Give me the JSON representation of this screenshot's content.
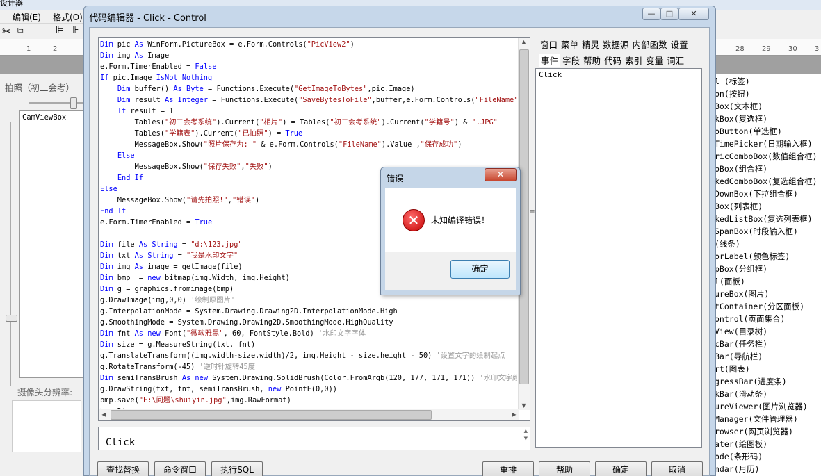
{
  "background": {
    "top_fragment": "设计器",
    "menu": [
      "编辑(E)",
      "格式(O)"
    ],
    "left_panel_title": "拍照（初二会考）",
    "cam_view_label": "CamViewBox",
    "resolution_label": "摄像头分辨率:",
    "ruler_left": [
      "1",
      "2"
    ],
    "ruler_right": [
      "28",
      "29",
      "30",
      "3"
    ],
    "toolbox_items": [
      "l (标签)",
      "on(按钮)",
      "Box(文本框)",
      "kBox(复选框)",
      "oButton(单选框)",
      "TimePicker(日期输入框)",
      "ricComboBox(数值组合框)",
      "oBox(组合框)",
      "kedComboBox(复选组合框)",
      "DownBox(下拉组合框)",
      "Box(列表框)",
      "kedListBox(复选列表框)",
      "SpanBox(时段输入框)",
      "(线条)",
      "orLabel(颜色标签)",
      "pBox(分组框)",
      "l(面板)",
      "ureBox(图片)",
      "tContainer(分区面板)",
      "ontrol(页面集合)",
      "View(目录树)",
      "cBar(任务栏)",
      "Bar(导航栏)",
      "rt(图表)",
      "gressBar(进度条)",
      "kBar(滑动条)",
      "ureViewer(图片浏览器)",
      "Manager(文件管理器)",
      "rowser(网页浏览器)",
      "ater(绘图板)",
      "ode(条形码)",
      "ndar(月历)"
    ]
  },
  "window": {
    "title": "代码编辑器 - Click - Control",
    "min": "—",
    "max": "□",
    "close": "✕"
  },
  "code_lines": [
    "Dim pic As WinForm.PictureBox = e.Form.Controls(\"PicView2\")",
    "Dim img As Image",
    "e.Form.TimerEnabled = False",
    "If pic.Image IsNot Nothing",
    "    Dim buffer() As Byte = Functions.Execute(\"GetImageToBytes\",pic.Image)",
    "    Dim result As Integer = Functions.Execute(\"SaveBytesToFile\",buffer,e.Form.Controls(\"FileName\").V:",
    "    If result = 1",
    "        Tables(\"初二会考系统\").Current(\"相片\") = Tables(\"初二会考系统\").Current(\"学籍号\") & \".JPG\"",
    "        Tables(\"学籍表\").Current(\"已拍照\") = True",
    "        MessageBox.Show(\"照片保存为: \" & e.Form.Controls(\"FileName\").Value ,\"保存成功\")",
    "    Else",
    "        MessageBox.Show(\"保存失败\",\"失败\")",
    "    End If",
    "Else",
    "    MessageBox.Show(\"请先拍照!\",\"错误\")",
    "End If",
    "e.Form.TimerEnabled = True",
    "",
    "Dim file As String = \"d:\\123.jpg\"",
    "Dim txt As String = \"我是水印文字\"",
    "Dim img As image = getImage(file)",
    "Dim bmp  = new bitmap(img.Width, img.Height)",
    "Dim g = graphics.fromimage(bmp)",
    "g.DrawImage(img,0,0) '绘制原图片'",
    "g.InterpolationMode = System.Drawing.Drawing2D.InterpolationMode.High",
    "g.SmoothingMode = System.Drawing.Drawing2D.SmoothingMode.HighQuality",
    "Dim fnt As new Font(\"微软雅黑\", 60, FontStyle.Bold) '水印文字字体",
    "Dim size = g.MeasureString(txt, fnt)",
    "g.TranslateTransform((img.width-size.width)/2, img.Height - size.height - 50) '设置文字的绘制起点",
    "g.RotateTransform(-45) '逆时针旋转45度",
    "Dim semiTransBrush As new System.Drawing.SolidBrush(Color.FromArgb(120, 177, 171, 171)) '水印文字颜色",
    "g.DrawString(txt, fnt, semiTransBrush, new PointF(0,0))",
    "bmp.save(\"E:\\问题\\shuiyin.jpg\",img.RawFormat)",
    "bmp.Dispose"
  ],
  "output_text": "Click",
  "tabs_row1": [
    "窗口",
    "菜单",
    "精灵",
    "数据源",
    "内部函数",
    "设置"
  ],
  "tabs_row2": [
    "事件",
    "字段",
    "帮助",
    "代码",
    "索引",
    "变量",
    "词汇"
  ],
  "event_item": "Click",
  "buttons_left": [
    "查找替换",
    "命令窗口",
    "执行SQL"
  ],
  "buttons_right": [
    "重排",
    "帮助",
    "确定",
    "取消"
  ],
  "dialog": {
    "title": "错误",
    "close": "✕",
    "message": "未知编译错误！",
    "ok": "确定"
  }
}
